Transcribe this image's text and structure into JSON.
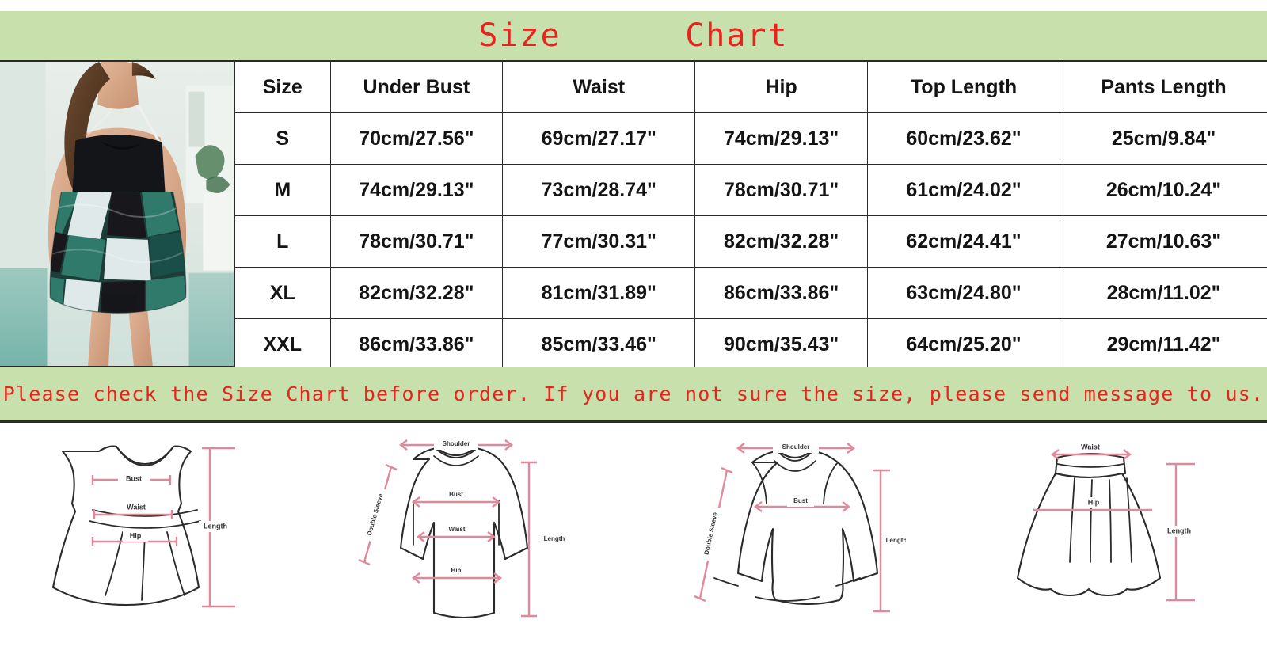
{
  "title": "Size      Chart",
  "colors": {
    "band_green": "#c7e0ac",
    "title_red": "#e8231d",
    "notice_red": "#e8231d",
    "border_dark": "#2b2b2b",
    "measure_pink": "#e0899b"
  },
  "product_photo": {
    "alt_name": "model-wearing-black-and-green-floral-tankini-swimdress"
  },
  "table": {
    "columns": [
      "Size",
      "Under Bust",
      "Waist",
      "Hip",
      "Top Length",
      "Pants Length"
    ],
    "rows": [
      {
        "size": "S",
        "under_bust": "70cm/27.56\"",
        "waist": "69cm/27.17\"",
        "hip": "74cm/29.13\"",
        "top_length": "60cm/23.62\"",
        "pants_length": "25cm/9.84\""
      },
      {
        "size": "M",
        "under_bust": "74cm/29.13\"",
        "waist": "73cm/28.74\"",
        "hip": "78cm/30.71\"",
        "top_length": "61cm/24.02\"",
        "pants_length": "26cm/10.24\""
      },
      {
        "size": "L",
        "under_bust": "78cm/30.71\"",
        "waist": "77cm/30.31\"",
        "hip": "82cm/32.28\"",
        "top_length": "62cm/24.41\"",
        "pants_length": "27cm/10.63\""
      },
      {
        "size": "XL",
        "under_bust": "82cm/32.28\"",
        "waist": "81cm/31.89\"",
        "hip": "86cm/33.86\"",
        "top_length": "63cm/24.80\"",
        "pants_length": "28cm/11.02\""
      },
      {
        "size": "XXL",
        "under_bust": "86cm/33.86\"",
        "waist": "85cm/33.46\"",
        "hip": "90cm/35.43\"",
        "top_length": "64cm/25.20\"",
        "pants_length": "29cm/11.42\""
      }
    ]
  },
  "notice": "Please check the Size Chart before order. If you are not sure the size, please send message to us.",
  "diagrams": [
    {
      "name": "sleeveless-dress",
      "labels": {
        "bust": "Bust",
        "waist": "Waist",
        "hip": "Hip",
        "length": "Length"
      }
    },
    {
      "name": "long-sleeve-top",
      "labels": {
        "shoulder": "Shoulder",
        "double_sleeve": "Double Sleeve",
        "bust": "Bust",
        "waist": "Waist",
        "hip": "Hip",
        "length": "Length"
      }
    },
    {
      "name": "sweatshirt",
      "labels": {
        "shoulder": "Shoulder",
        "double_sleeve": "Double Sleeve",
        "bust": "Bust",
        "length": "Length"
      }
    },
    {
      "name": "skirt",
      "labels": {
        "waist": "Waist",
        "hip": "Hip",
        "length": "Length"
      }
    }
  ],
  "chart_data": {
    "type": "table",
    "title": "Size Chart",
    "categories": [
      "S",
      "M",
      "L",
      "XL",
      "XXL"
    ],
    "columns": [
      "Size",
      "Under Bust",
      "Waist",
      "Hip",
      "Top Length",
      "Pants Length"
    ],
    "units": "cm / inches",
    "series": [
      {
        "name": "Under Bust (cm)",
        "values": [
          70,
          74,
          78,
          82,
          86
        ]
      },
      {
        "name": "Under Bust (in)",
        "values": [
          27.56,
          29.13,
          30.71,
          32.28,
          33.86
        ]
      },
      {
        "name": "Waist (cm)",
        "values": [
          69,
          73,
          77,
          81,
          85
        ]
      },
      {
        "name": "Waist (in)",
        "values": [
          27.17,
          28.74,
          30.31,
          31.89,
          33.46
        ]
      },
      {
        "name": "Hip (cm)",
        "values": [
          74,
          78,
          82,
          86,
          90
        ]
      },
      {
        "name": "Hip (in)",
        "values": [
          29.13,
          30.71,
          32.28,
          33.86,
          35.43
        ]
      },
      {
        "name": "Top Length (cm)",
        "values": [
          60,
          61,
          62,
          63,
          64
        ]
      },
      {
        "name": "Top Length (in)",
        "values": [
          23.62,
          24.02,
          24.41,
          24.8,
          25.2
        ]
      },
      {
        "name": "Pants Length (cm)",
        "values": [
          25,
          26,
          27,
          28,
          29
        ]
      },
      {
        "name": "Pants Length (in)",
        "values": [
          9.84,
          10.24,
          10.63,
          11.02,
          11.42
        ]
      }
    ]
  }
}
